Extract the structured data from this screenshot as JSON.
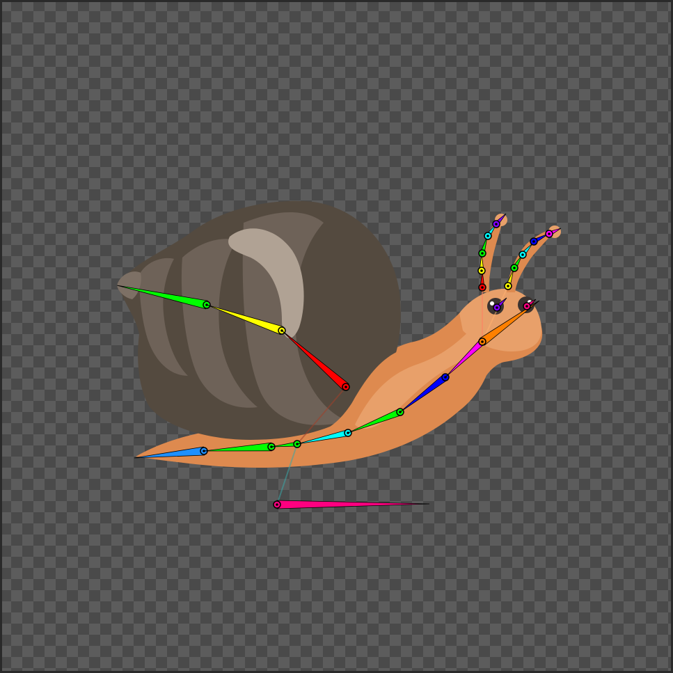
{
  "canvas": {
    "checker_light": "#5c5c5c",
    "checker_dark": "#4a4a4a",
    "border_color": "#2a2a2a"
  },
  "artwork": {
    "subject": "snail",
    "shell_colors": [
      "#6e6258",
      "#544a3f",
      "#b0a294"
    ],
    "body_colors": [
      "#de8a4f",
      "#e8a06a",
      "#f0b383"
    ],
    "eye_color": "#3b3330"
  },
  "skeleton": {
    "bone_colors": [
      "#ff0000",
      "#ffff00",
      "#00ff00",
      "#00ffff",
      "#0000ff",
      "#ff00ff",
      "#ff8000",
      "#ff0080",
      "#1e90ff",
      "#8000ff"
    ],
    "joint_color": "#000000",
    "bone_count": 27
  }
}
